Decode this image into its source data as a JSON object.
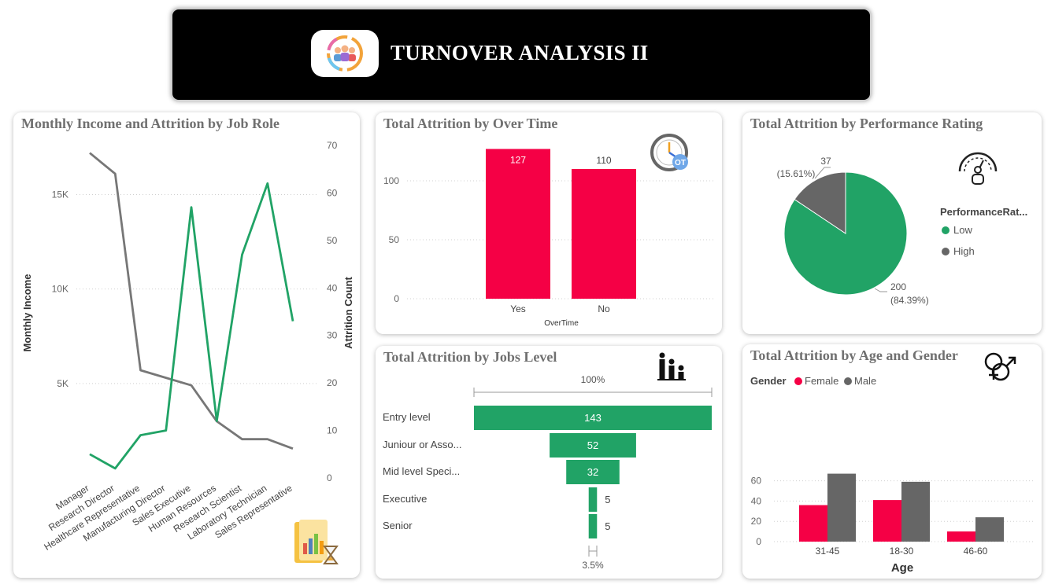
{
  "header": {
    "title": "TURNOVER ANALYSIS II",
    "logo_icon": "team-turnover-icon"
  },
  "colors": {
    "green": "#21A366",
    "grey": "#777777",
    "red": "#F50045",
    "dark_grey": "#666666"
  },
  "panels": {
    "income": {
      "title": "Monthly Income and Attrition by Job Role",
      "icon": "report-hourglass-icon"
    },
    "overtime": {
      "title": "Total Attrition by Over Time",
      "icon": "overtime-clock-icon"
    },
    "performance": {
      "title": "Total Attrition by Performance Rating",
      "icon": "performance-gauge-icon"
    },
    "jobs_level": {
      "title": "Total Attrition by Jobs Level",
      "icon": "hierarchy-people-icon"
    },
    "age_gender": {
      "title": "Total Attrition by Age and Gender",
      "icon": "gender-symbol-icon"
    }
  },
  "chart_data": [
    {
      "id": "income",
      "type": "line",
      "title": "Monthly Income and Attrition by Job Role",
      "categories": [
        "Manager",
        "Research Director",
        "Healthcare Representative",
        "Manufacturing Director",
        "Sales Executive",
        "Human Resources",
        "Research Scientist",
        "Laboratory Technician",
        "Sales Representative"
      ],
      "series": [
        {
          "name": "Monthly Income",
          "axis": "left",
          "values": [
            17200,
            16100,
            5700,
            5300,
            4900,
            3000,
            2050,
            2050,
            1550
          ]
        },
        {
          "name": "Attrition Count",
          "axis": "right",
          "values": [
            5,
            2,
            9,
            10,
            57,
            12,
            47,
            62,
            33
          ]
        }
      ],
      "ylabel": "Monthly Income",
      "y2label": "Attrition Count",
      "yticks": [
        "5K",
        "10K",
        "15K"
      ],
      "y2ticks": [
        "0",
        "10",
        "20",
        "30",
        "40",
        "50",
        "60",
        "70"
      ],
      "ylim": [
        0,
        17600
      ],
      "y2lim": [
        0,
        70
      ],
      "grid": true
    },
    {
      "id": "overtime",
      "type": "bar",
      "title": "Total Attrition by Over Time",
      "categories": [
        "Yes",
        "No"
      ],
      "values": [
        127,
        110
      ],
      "data_labels": [
        "127",
        "110"
      ],
      "xlabel": "OverTime",
      "yticks": [
        "0",
        "50",
        "100"
      ],
      "ylim": [
        0,
        140
      ],
      "grid": true
    },
    {
      "id": "performance",
      "type": "pie",
      "title": "Total Attrition by Performance Rating",
      "legend_title": "PerformanceRat...",
      "labels": [
        "Low",
        "High"
      ],
      "values": [
        200,
        37
      ],
      "data_labels": [
        [
          "200",
          "(84.39%)"
        ],
        [
          "37",
          "(15.61%)"
        ]
      ],
      "legend": "right"
    },
    {
      "id": "jobs_level",
      "type": "bar",
      "orientation": "funnel",
      "title": "Total Attrition by Jobs Level",
      "categories": [
        "Entry level",
        "Juniour or Asso...",
        "Mid level Speci...",
        "Executive",
        "Senior"
      ],
      "values": [
        143,
        52,
        32,
        5,
        5
      ],
      "data_labels": [
        "143",
        "52",
        "32",
        "5",
        "5"
      ],
      "top_percent": "100%",
      "bottom_percent": "3.5%"
    },
    {
      "id": "age_gender",
      "type": "bar",
      "title": "Total Attrition by Age and Gender",
      "legend_title": "Gender",
      "categories": [
        "31-45",
        "18-30",
        "46-60"
      ],
      "series": [
        {
          "name": "Female",
          "values": [
            36,
            41,
            10
          ]
        },
        {
          "name": "Male",
          "values": [
            67,
            59,
            24
          ]
        }
      ],
      "xlabel": "Age",
      "yticks": [
        "0",
        "20",
        "40",
        "60"
      ],
      "ylim": [
        0,
        70
      ],
      "legend": "top-left",
      "grid": true
    }
  ]
}
